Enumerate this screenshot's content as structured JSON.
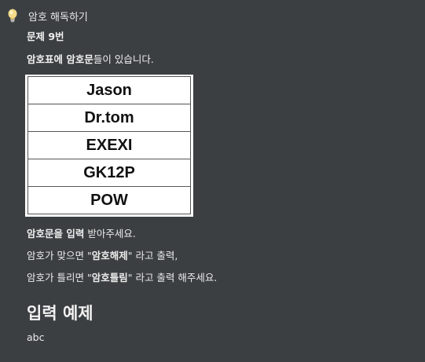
{
  "header": {
    "icon": "lightbulb-icon",
    "title": "암호 해독하기"
  },
  "problem": {
    "number": "문제 9번",
    "intro_part1": "암호표에 ",
    "intro_bold": "암호문",
    "intro_part2": "들이 있습니다."
  },
  "cipher_table": {
    "rows": [
      "Jason",
      "Dr.tom",
      "EXEXI",
      "GK12P",
      "POW"
    ]
  },
  "instructions": {
    "line1_part1": "암호문을 ",
    "line1_bold": "입력",
    "line1_part2": " 받아주세요.",
    "line2_part1": "암호가 맞으면 \"",
    "line2_bold": "암호해제",
    "line2_part2": "\" 라고 출력,",
    "line3_part1": "암호가 틀리면 \"",
    "line3_bold": "암호틀림",
    "line3_part2": "\" 라고 출력 해주세요."
  },
  "input_example": {
    "title": "입력 예제",
    "value": "abc"
  }
}
